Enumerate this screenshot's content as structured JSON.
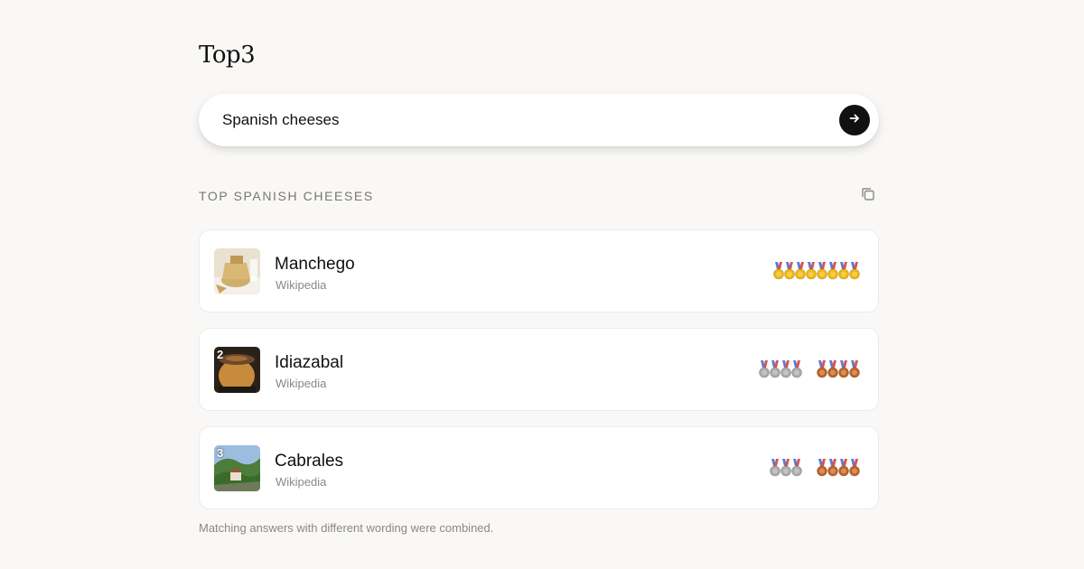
{
  "app": {
    "title": "Top3"
  },
  "search": {
    "value": "Spanish cheeses",
    "placeholder": "",
    "submit_icon": "arrow-right-icon"
  },
  "results": {
    "heading": "TOP SPANISH CHEESES",
    "copy_icon": "copy-icon",
    "items": [
      {
        "rank": "1",
        "name": "Manchego",
        "source": "Wikipedia",
        "medals": {
          "gold": 8,
          "silver": 0,
          "bronze": 0
        }
      },
      {
        "rank": "2",
        "name": "Idiazabal",
        "source": "Wikipedia",
        "medals": {
          "gold": 0,
          "silver": 4,
          "bronze": 4
        }
      },
      {
        "rank": "3",
        "name": "Cabrales",
        "source": "Wikipedia",
        "medals": {
          "gold": 0,
          "silver": 3,
          "bronze": 4
        }
      }
    ]
  },
  "footer": {
    "note": "Matching answers with different wording were combined."
  },
  "colors": {
    "background": "#f9f8f6",
    "gold": "#f2b705",
    "silver": "#a9a9a9",
    "bronze": "#c0611f",
    "ribbon_blue": "#5b7bd5",
    "ribbon_red": "#d9534f"
  }
}
